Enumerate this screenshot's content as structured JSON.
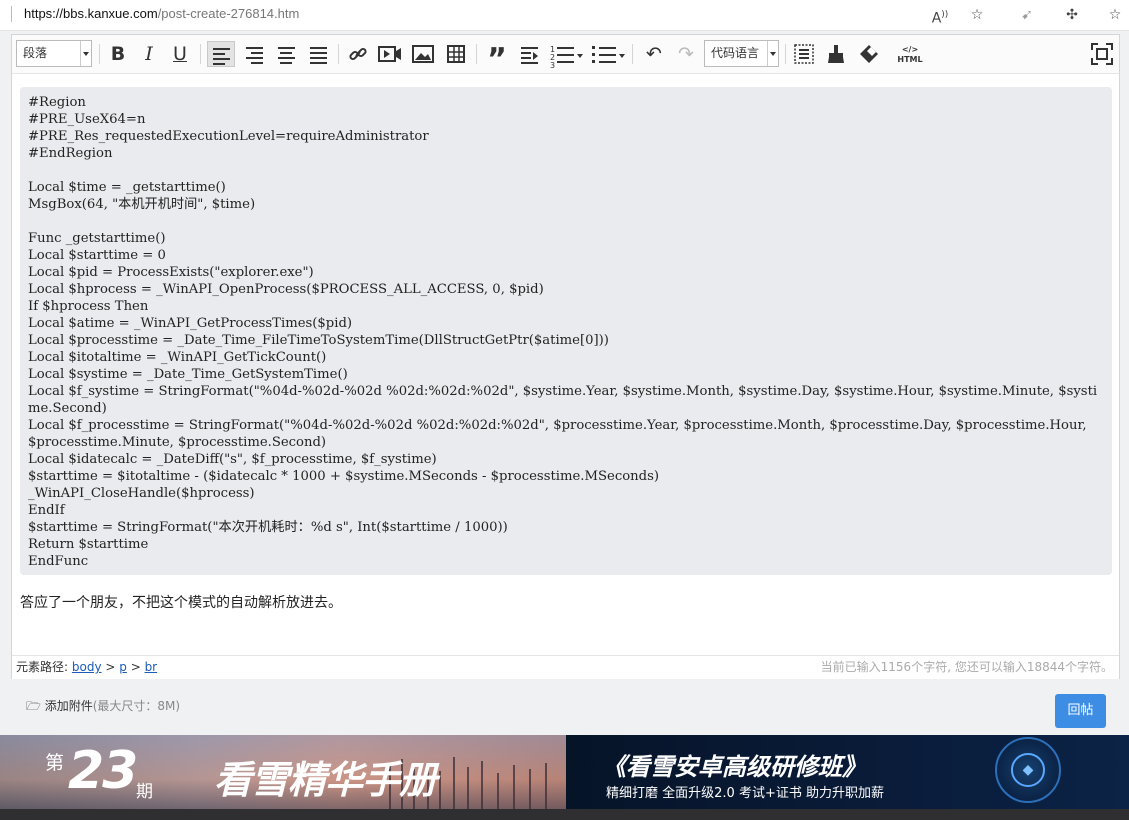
{
  "browser": {
    "url_host": "https://bbs.kanxue.com",
    "url_path": "/post-create-276814.htm"
  },
  "toolbar": {
    "paragraph_select": "段落",
    "code_language_select": "代码语言"
  },
  "editor": {
    "code_block": "#Region\n#PRE_UseX64=n\n#PRE_Res_requestedExecutionLevel=requireAdministrator\n#EndRegion\n\nLocal $time = _getstarttime()\nMsgBox(64, \"本机开机时间\", $time)\n\nFunc _getstarttime()\nLocal $starttime = 0\nLocal $pid = ProcessExists(\"explorer.exe\")\nLocal $hprocess = _WinAPI_OpenProcess($PROCESS_ALL_ACCESS, 0, $pid)\nIf $hprocess Then\nLocal $atime = _WinAPI_GetProcessTimes($pid)\nLocal $processtime = _Date_Time_FileTimeToSystemTime(DllStructGetPtr($atime[0]))\nLocal $itotaltime = _WinAPI_GetTickCount()\nLocal $systime = _Date_Time_GetSystemTime()\nLocal $f_systime = StringFormat(\"%04d-%02d-%02d %02d:%02d:%02d\", $systime.Year, $systime.Month, $systime.Day, $systime.Hour, $systime.Minute, $systime.Second)\nLocal $f_processtime = StringFormat(\"%04d-%02d-%02d %02d:%02d:%02d\", $processtime.Year, $processtime.Month, $processtime.Day, $processtime.Hour, $processtime.Minute, $processtime.Second)\nLocal $idatecalc = _DateDiff(\"s\", $f_processtime, $f_systime)\n$starttime = $itotaltime - ($idatecalc * 1000 + $systime.MSeconds - $processtime.MSeconds)\n_WinAPI_CloseHandle($hprocess)\nEndIf\n$starttime = StringFormat(\"本次开机耗时：%d s\", Int($starttime / 1000))\nReturn $starttime\nEndFunc",
    "paragraph_text": "答应了一个朋友，不把这个模式的自动解析放进去。"
  },
  "statusbar": {
    "path_label": "元素路径:",
    "path_body": "body",
    "path_p": "p",
    "path_br": "br",
    "char_count": "当前已输入1156个字符, 您还可以输入18844个字符。"
  },
  "attachment": {
    "label": "添加附件",
    "limit": "(最大尺寸：8M)"
  },
  "reply_button": "回帖",
  "banners": {
    "left": {
      "di": "第",
      "number": "23",
      "qi": "期",
      "title": "看雪精华手册"
    },
    "right": {
      "title": "《看雪安卓高级研修班》",
      "subtitle": "精细打磨  全面升级2.0   考试+证书  助力升职加薪"
    }
  },
  "icons": [
    "read-aloud-icon",
    "favorite-icon",
    "extensions-icon",
    "collections-icon",
    "bold-icon",
    "italic-icon",
    "underline-icon",
    "link-icon",
    "video-icon",
    "image-icon",
    "table-icon",
    "quote-icon",
    "indent-icon",
    "ordered-list-icon",
    "unordered-list-icon",
    "undo-icon",
    "redo-icon",
    "html-icon",
    "fullscreen-icon"
  ]
}
